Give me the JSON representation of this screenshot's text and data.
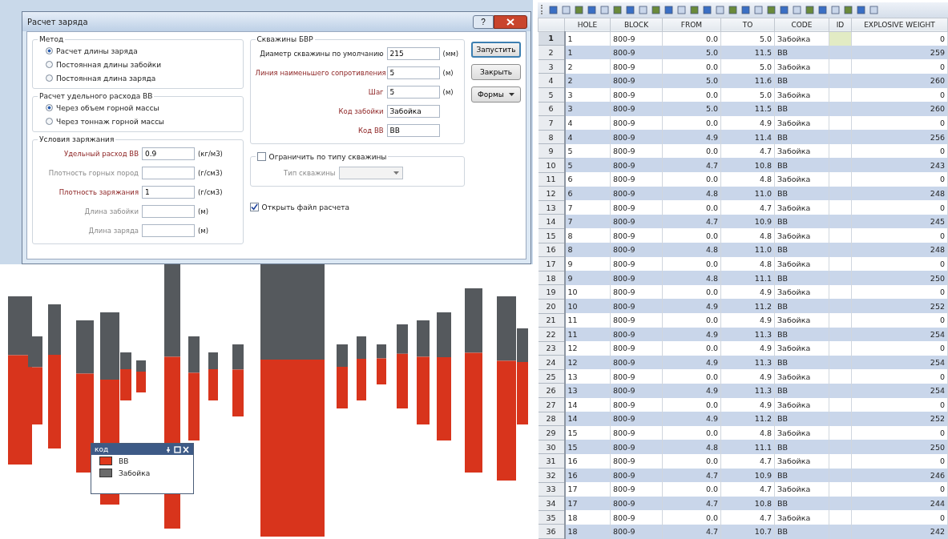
{
  "dialog": {
    "title": "Расчет заряда",
    "help_button": "?",
    "method_group": {
      "title": "Метод",
      "options": [
        {
          "label": "Расчет длины заряда",
          "selected": true
        },
        {
          "label": "Постоянная длины забойки",
          "selected": false
        },
        {
          "label": "Постоянная длина заряда",
          "selected": false
        }
      ]
    },
    "consumption_group": {
      "title": "Расчет удельного расхода ВВ",
      "options": [
        {
          "label": "Через объем горной массы",
          "selected": true
        },
        {
          "label": "Через тоннаж горной массы",
          "selected": false
        }
      ]
    },
    "charging_group": {
      "title": "Условия заряжания",
      "fields": [
        {
          "label": "Удельный расход ВВ",
          "kind": "required",
          "value": "0.9",
          "unit": "(кг/м3)"
        },
        {
          "label": "Плотность горных пород",
          "kind": "disabled",
          "unit": "(г/см3)"
        },
        {
          "label": "Плотность заряжания",
          "kind": "required",
          "value": "1",
          "unit": "(г/см3)"
        },
        {
          "label": "Длина забойки",
          "kind": "disabled",
          "unit": "(м)"
        },
        {
          "label": "Длина заряда",
          "kind": "disabled",
          "unit": "(м)"
        }
      ]
    },
    "holes_group": {
      "title": "Скважины БВР",
      "fields": [
        {
          "label": "Диаметр скважины по умолчанию",
          "kind": "normal",
          "value": "215",
          "unit": "(мм)"
        },
        {
          "label": "Линия наименьшего сопротивления",
          "kind": "required",
          "value": "5",
          "unit": "(м)"
        },
        {
          "label": "Шаг",
          "kind": "required",
          "value": "5",
          "unit": "(м)"
        },
        {
          "label": "Код забойки",
          "kind": "required",
          "value": "Забойка"
        },
        {
          "label": "Код ВВ",
          "kind": "required",
          "value": "ВВ"
        }
      ]
    },
    "limit_group": {
      "label": "Ограничить по типу скважины",
      "checked": false,
      "type_label": "Тип скважины"
    },
    "open_file": {
      "label": "Открыть файл расчета",
      "checked": true
    },
    "buttons": [
      {
        "label": "Запустить",
        "kind": "default"
      },
      {
        "label": "Закрыть",
        "kind": "plain"
      },
      {
        "label": "Формы",
        "kind": "split"
      }
    ]
  },
  "legend": {
    "title": "код",
    "items": [
      {
        "label": "ВВ",
        "color": "#e0391c"
      },
      {
        "label": "Забойка",
        "color": "#6b6b6b"
      }
    ]
  },
  "table": {
    "columns": [
      "HOLE",
      "BLOCK",
      "FROM",
      "TO",
      "CODE",
      "ID",
      "EXPLOSIVE WEIGHT"
    ],
    "rows": [
      {
        "num": "1",
        "hole": "1",
        "block": "800-9",
        "from": "0.0",
        "to": "5.0",
        "code": "Забойка",
        "weight": "0",
        "selected": true
      },
      {
        "num": "2",
        "hole": "1",
        "block": "800-9",
        "from": "5.0",
        "to": "11.5",
        "code": "ВВ",
        "weight": "259",
        "selected": false
      },
      {
        "num": "3",
        "hole": "2",
        "block": "800-9",
        "from": "0.0",
        "to": "5.0",
        "code": "Забойка",
        "weight": "0",
        "selected": false
      },
      {
        "num": "4",
        "hole": "2",
        "block": "800-9",
        "from": "5.0",
        "to": "11.6",
        "code": "ВВ",
        "weight": "260",
        "selected": false
      },
      {
        "num": "5",
        "hole": "3",
        "block": "800-9",
        "from": "0.0",
        "to": "5.0",
        "code": "Забойка",
        "weight": "0",
        "selected": false
      },
      {
        "num": "6",
        "hole": "3",
        "block": "800-9",
        "from": "5.0",
        "to": "11.5",
        "code": "ВВ",
        "weight": "260",
        "selected": false
      },
      {
        "num": "7",
        "hole": "4",
        "block": "800-9",
        "from": "0.0",
        "to": "4.9",
        "code": "Забойка",
        "weight": "0",
        "selected": false
      },
      {
        "num": "8",
        "hole": "4",
        "block": "800-9",
        "from": "4.9",
        "to": "11.4",
        "code": "ВВ",
        "weight": "256",
        "selected": false
      },
      {
        "num": "9",
        "hole": "5",
        "block": "800-9",
        "from": "0.0",
        "to": "4.7",
        "code": "Забойка",
        "weight": "0",
        "selected": false
      },
      {
        "num": "10",
        "hole": "5",
        "block": "800-9",
        "from": "4.7",
        "to": "10.8",
        "code": "ВВ",
        "weight": "243",
        "selected": false
      },
      {
        "num": "11",
        "hole": "6",
        "block": "800-9",
        "from": "0.0",
        "to": "4.8",
        "code": "Забойка",
        "weight": "0",
        "selected": false
      },
      {
        "num": "12",
        "hole": "6",
        "block": "800-9",
        "from": "4.8",
        "to": "11.0",
        "code": "ВВ",
        "weight": "248",
        "selected": false
      },
      {
        "num": "13",
        "hole": "7",
        "block": "800-9",
        "from": "0.0",
        "to": "4.7",
        "code": "Забойка",
        "weight": "0",
        "selected": false
      },
      {
        "num": "14",
        "hole": "7",
        "block": "800-9",
        "from": "4.7",
        "to": "10.9",
        "code": "ВВ",
        "weight": "245",
        "selected": false
      },
      {
        "num": "15",
        "hole": "8",
        "block": "800-9",
        "from": "0.0",
        "to": "4.8",
        "code": "Забойка",
        "weight": "0",
        "selected": false
      },
      {
        "num": "16",
        "hole": "8",
        "block": "800-9",
        "from": "4.8",
        "to": "11.0",
        "code": "ВВ",
        "weight": "248",
        "selected": false
      },
      {
        "num": "17",
        "hole": "9",
        "block": "800-9",
        "from": "0.0",
        "to": "4.8",
        "code": "Забойка",
        "weight": "0",
        "selected": false
      },
      {
        "num": "18",
        "hole": "9",
        "block": "800-9",
        "from": "4.8",
        "to": "11.1",
        "code": "ВВ",
        "weight": "250",
        "selected": false
      },
      {
        "num": "19",
        "hole": "10",
        "block": "800-9",
        "from": "0.0",
        "to": "4.9",
        "code": "Забойка",
        "weight": "0",
        "selected": false
      },
      {
        "num": "20",
        "hole": "10",
        "block": "800-9",
        "from": "4.9",
        "to": "11.2",
        "code": "ВВ",
        "weight": "252",
        "selected": false
      },
      {
        "num": "21",
        "hole": "11",
        "block": "800-9",
        "from": "0.0",
        "to": "4.9",
        "code": "Забойка",
        "weight": "0",
        "selected": false
      },
      {
        "num": "22",
        "hole": "11",
        "block": "800-9",
        "from": "4.9",
        "to": "11.3",
        "code": "ВВ",
        "weight": "254",
        "selected": false
      },
      {
        "num": "23",
        "hole": "12",
        "block": "800-9",
        "from": "0.0",
        "to": "4.9",
        "code": "Забойка",
        "weight": "0",
        "selected": false
      },
      {
        "num": "24",
        "hole": "12",
        "block": "800-9",
        "from": "4.9",
        "to": "11.3",
        "code": "ВВ",
        "weight": "254",
        "selected": false
      },
      {
        "num": "25",
        "hole": "13",
        "block": "800-9",
        "from": "0.0",
        "to": "4.9",
        "code": "Забойка",
        "weight": "0",
        "selected": false
      },
      {
        "num": "26",
        "hole": "13",
        "block": "800-9",
        "from": "4.9",
        "to": "11.3",
        "code": "ВВ",
        "weight": "254",
        "selected": false
      },
      {
        "num": "27",
        "hole": "14",
        "block": "800-9",
        "from": "0.0",
        "to": "4.9",
        "code": "Забойка",
        "weight": "0",
        "selected": false
      },
      {
        "num": "28",
        "hole": "14",
        "block": "800-9",
        "from": "4.9",
        "to": "11.2",
        "code": "ВВ",
        "weight": "252",
        "selected": false
      },
      {
        "num": "29",
        "hole": "15",
        "block": "800-9",
        "from": "0.0",
        "to": "4.8",
        "code": "Забойка",
        "weight": "0",
        "selected": false
      },
      {
        "num": "30",
        "hole": "15",
        "block": "800-9",
        "from": "4.8",
        "to": "11.1",
        "code": "ВВ",
        "weight": "250",
        "selected": false
      },
      {
        "num": "31",
        "hole": "16",
        "block": "800-9",
        "from": "0.0",
        "to": "4.7",
        "code": "Забойка",
        "weight": "0",
        "selected": false
      },
      {
        "num": "32",
        "hole": "16",
        "block": "800-9",
        "from": "4.7",
        "to": "10.9",
        "code": "ВВ",
        "weight": "246",
        "selected": false
      },
      {
        "num": "33",
        "hole": "17",
        "block": "800-9",
        "from": "0.0",
        "to": "4.7",
        "code": "Забойка",
        "weight": "0",
        "selected": false
      },
      {
        "num": "34",
        "hole": "17",
        "block": "800-9",
        "from": "4.7",
        "to": "10.8",
        "code": "ВВ",
        "weight": "244",
        "selected": false
      },
      {
        "num": "35",
        "hole": "18",
        "block": "800-9",
        "from": "0.0",
        "to": "4.7",
        "code": "Забойка",
        "weight": "0",
        "selected": false
      },
      {
        "num": "36",
        "hole": "18",
        "block": "800-9",
        "from": "4.7",
        "to": "10.7",
        "code": "ВВ",
        "weight": "242",
        "selected": false
      }
    ]
  }
}
